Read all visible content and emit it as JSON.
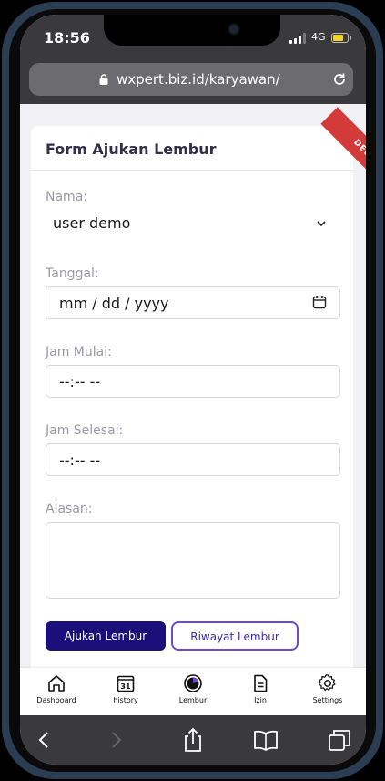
{
  "status_bar": {
    "time": "18:56",
    "network": "4G"
  },
  "browser": {
    "url": "wxpert.biz.id/karyawan/"
  },
  "debug_ribbon": "DEBUG",
  "form": {
    "title": "Form Ajukan Lembur",
    "nama": {
      "label": "Nama:",
      "value": "user demo"
    },
    "tanggal": {
      "label": "Tanggal:",
      "value": "mm / dd / yyyy"
    },
    "jam_mulai": {
      "label": "Jam Mulai:",
      "value": "--:--  --"
    },
    "jam_selesai": {
      "label": "Jam Selesai:",
      "value": "--:--  --"
    },
    "alasan": {
      "label": "Alasan:",
      "value": ""
    },
    "submit_label": "Ajukan Lembur",
    "history_label": "Riwayat Lembur"
  },
  "tabs": [
    {
      "label": "Dashboard",
      "icon": "home-icon"
    },
    {
      "label": "history",
      "icon": "calendar-icon"
    },
    {
      "label": "Lembur",
      "icon": "timer-icon"
    },
    {
      "label": "Izin",
      "icon": "document-icon"
    },
    {
      "label": "Settings",
      "icon": "gear-icon"
    }
  ],
  "calendar_day": "31",
  "colors": {
    "primary": "#1d0f7a",
    "accent_border": "#6b4bd1",
    "ribbon": "#d33a3a"
  }
}
